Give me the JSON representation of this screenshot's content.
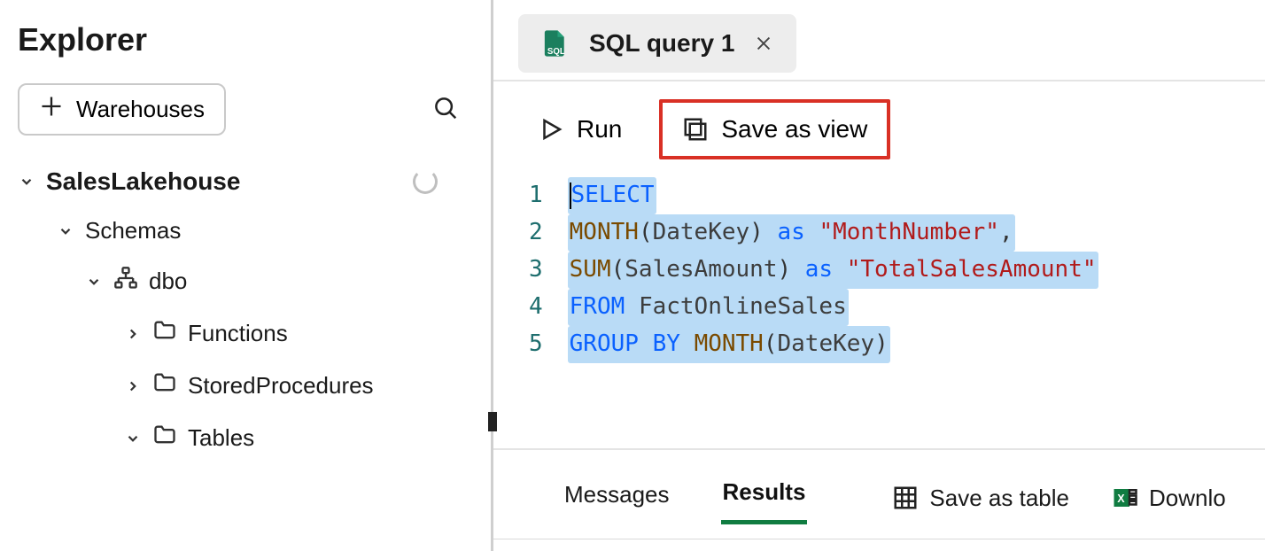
{
  "explorer": {
    "title": "Explorer",
    "warehouses_button": "Warehouses",
    "tree": {
      "root": "SalesLakehouse",
      "schemas_label": "Schemas",
      "schema_name": "dbo",
      "folders": {
        "functions": "Functions",
        "stored_procedures": "StoredProcedures",
        "tables": "Tables"
      }
    }
  },
  "tab": {
    "title": "SQL query 1"
  },
  "toolbar": {
    "run": "Run",
    "save_as_view": "Save as view"
  },
  "editor": {
    "line1": {
      "select": "SELECT"
    },
    "line2": {
      "month_fn": "MONTH",
      "open": "(",
      "arg": "DateKey",
      "close": ")",
      "as": "as",
      "alias": "\"MonthNumber\"",
      "comma": ","
    },
    "line3": {
      "sum_fn": "SUM",
      "open": "(",
      "arg": "SalesAmount",
      "close": ")",
      "as": "as",
      "alias": "\"TotalSalesAmount\""
    },
    "line4": {
      "from": "FROM",
      "table": "FactOnlineSales"
    },
    "line5": {
      "group": "GROUP",
      "by": "BY",
      "month_fn": "MONTH",
      "open": "(",
      "arg": "DateKey",
      "close": ")"
    },
    "line_numbers": [
      "1",
      "2",
      "3",
      "4",
      "5"
    ]
  },
  "results": {
    "messages_tab": "Messages",
    "results_tab": "Results",
    "save_as_table": "Save as table",
    "download": "Downlo"
  }
}
